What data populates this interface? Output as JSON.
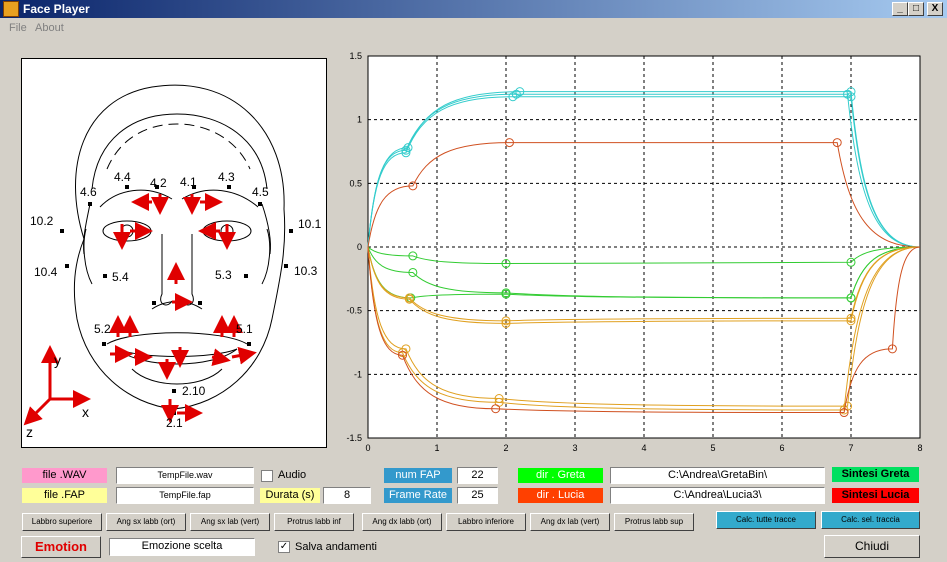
{
  "window": {
    "title": "Face Player",
    "min_label": "_",
    "max_label": "□",
    "close_label": "X"
  },
  "menu": {
    "file": "File",
    "about": "About"
  },
  "face_labels": [
    "4.4",
    "4.2",
    "4.1",
    "4.3",
    "4.6",
    "4.5",
    "10.2",
    "10.1",
    "10.4",
    "10.3",
    "5.4",
    "5.3",
    "5.2",
    "5.1",
    "2.10",
    "2.1"
  ],
  "axis_labels": {
    "y": "y",
    "x": "x",
    "z": "z"
  },
  "chart_data": {
    "type": "line",
    "xlim": [
      0,
      8
    ],
    "ylim": [
      -1.5,
      1.5
    ],
    "x_ticks": [
      "0",
      "1",
      "2",
      "3",
      "4",
      "5",
      "6",
      "7",
      "8"
    ],
    "y_ticks": [
      "1.5",
      "1",
      "0.5",
      "0",
      "-0.5",
      "-1",
      "-1.5"
    ],
    "grid": true,
    "series": [
      {
        "color": "#33cccc",
        "values": [
          [
            0,
            0
          ],
          [
            0.55,
            0.74
          ],
          [
            2.1,
            1.18
          ],
          [
            7,
            1.18
          ],
          [
            8,
            0
          ]
        ]
      },
      {
        "color": "#33cccc",
        "values": [
          [
            0,
            0
          ],
          [
            0.55,
            0.76
          ],
          [
            2.15,
            1.2
          ],
          [
            6.95,
            1.2
          ],
          [
            8,
            0
          ]
        ]
      },
      {
        "color": "#33cccc",
        "values": [
          [
            0,
            0
          ],
          [
            0.58,
            0.78
          ],
          [
            2.2,
            1.22
          ],
          [
            7,
            1.22
          ],
          [
            8,
            0
          ]
        ]
      },
      {
        "color": "#d05020",
        "values": [
          [
            0,
            0
          ],
          [
            0.65,
            0.48
          ],
          [
            2.05,
            0.82
          ],
          [
            6.8,
            0.82
          ],
          [
            8,
            0
          ]
        ]
      },
      {
        "color": "#33cc33",
        "values": [
          [
            0,
            0
          ],
          [
            0.65,
            -0.07
          ],
          [
            2,
            -0.13
          ],
          [
            7,
            -0.12
          ],
          [
            8,
            0
          ]
        ]
      },
      {
        "color": "#33cc33",
        "values": [
          [
            0,
            0
          ],
          [
            0.65,
            -0.2
          ],
          [
            2,
            -0.36
          ],
          [
            7,
            -0.4
          ],
          [
            8,
            0
          ]
        ]
      },
      {
        "color": "#33cc33",
        "values": [
          [
            0,
            0
          ],
          [
            0.62,
            -0.4
          ],
          [
            2,
            -0.37
          ],
          [
            7,
            -0.4
          ],
          [
            8,
            0
          ]
        ]
      },
      {
        "color": "#e0a020",
        "values": [
          [
            0,
            0
          ],
          [
            0.6,
            -0.4
          ],
          [
            2,
            -0.58
          ],
          [
            7,
            -0.56
          ],
          [
            8,
            0
          ]
        ]
      },
      {
        "color": "#e0a020",
        "values": [
          [
            0,
            0
          ],
          [
            0.6,
            -0.41
          ],
          [
            2,
            -0.6
          ],
          [
            7,
            -0.58
          ],
          [
            8,
            0
          ]
        ]
      },
      {
        "color": "#e0a020",
        "values": [
          [
            0,
            0
          ],
          [
            0.55,
            -0.8
          ],
          [
            1.9,
            -1.19
          ],
          [
            6.95,
            -1.25
          ],
          [
            8,
            0
          ]
        ]
      },
      {
        "color": "#e0a020",
        "values": [
          [
            0,
            0
          ],
          [
            0.5,
            -0.83
          ],
          [
            1.9,
            -1.22
          ],
          [
            6.9,
            -1.28
          ],
          [
            8,
            0
          ]
        ]
      },
      {
        "color": "#d05020",
        "values": [
          [
            0,
            0
          ],
          [
            0.5,
            -0.85
          ],
          [
            1.85,
            -1.27
          ],
          [
            6.9,
            -1.3
          ],
          [
            7.6,
            -0.8
          ],
          [
            8,
            0
          ]
        ]
      }
    ]
  },
  "controls": {
    "file_wav_label": "file .WAV",
    "file_wav_value": "TempFile.wav",
    "file_fap_label": "file .FAP",
    "file_fap_value": "TempFile.fap",
    "audio_label": "Audio",
    "durata_label": "Durata (s)",
    "durata_value": "8",
    "num_fap_label": "num FAP",
    "num_fap_value": "22",
    "frame_rate_label": "Frame Rate",
    "frame_rate_value": "25",
    "dir_greta_label": "dir . Greta",
    "dir_greta_value": "C:\\Andrea\\GretaBin\\",
    "dir_lucia_label": "dir . Lucia",
    "dir_lucia_value": "C:\\Andrea\\Lucia3\\",
    "sintesi_greta": "Sintesi Greta",
    "sintesi_lucia": "Sintesi Lucia",
    "buttons": [
      "Labbro superiore",
      "Ang sx labb (ort)",
      "Ang sx lab (vert)",
      "Protrus labb inf",
      "Ang dx labb (ort)",
      "Labbro inferiore",
      "Ang dx lab (vert)",
      "Protrus labb sup"
    ],
    "calc_all": "Calc. tutte tracce",
    "calc_sel": "Calc. sel. traccia",
    "emotion": "Emotion",
    "emotion_value": "Emozione scelta",
    "salva_label": "Salva andamenti",
    "salva_check": "✓",
    "chiudi": "Chiudi"
  }
}
